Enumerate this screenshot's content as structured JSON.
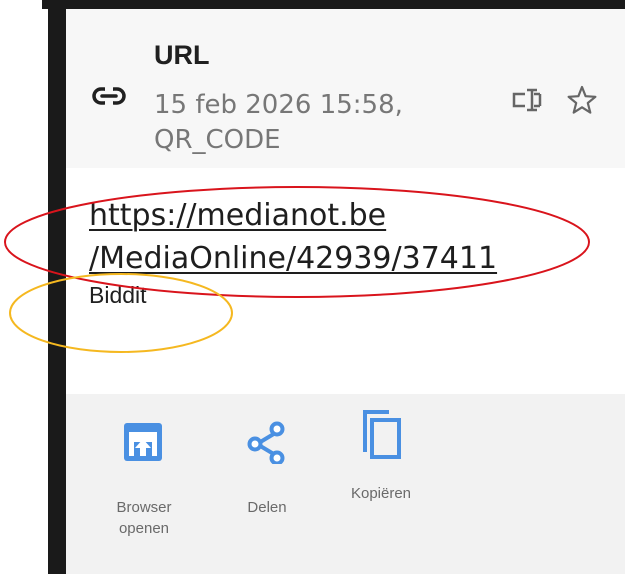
{
  "header": {
    "title": "URL",
    "meta_line1": "15 feb 2026 15:58,",
    "meta_line2": "QR_CODE",
    "link_icon": "link-icon",
    "text_select_icon": "text-select-icon",
    "star_icon": "star-outline-icon"
  },
  "content": {
    "url_line1": "https://medianot.be",
    "url_line2": "/MediaOnline/42939/37411",
    "note": "Biddit"
  },
  "actions": [
    {
      "label_line1": "Browser",
      "label_line2": "openen",
      "icon": "open-in-browser-icon"
    },
    {
      "label_line1": "Delen",
      "label_line2": "",
      "icon": "share-icon"
    },
    {
      "label_line1": "Kopiëren",
      "label_line2": "",
      "icon": "copy-icon"
    }
  ],
  "colors": {
    "accent": "#4a90e2",
    "annotation_red": "#d9141c",
    "annotation_yellow": "#f5b820",
    "frame": "#1a1a1a"
  }
}
